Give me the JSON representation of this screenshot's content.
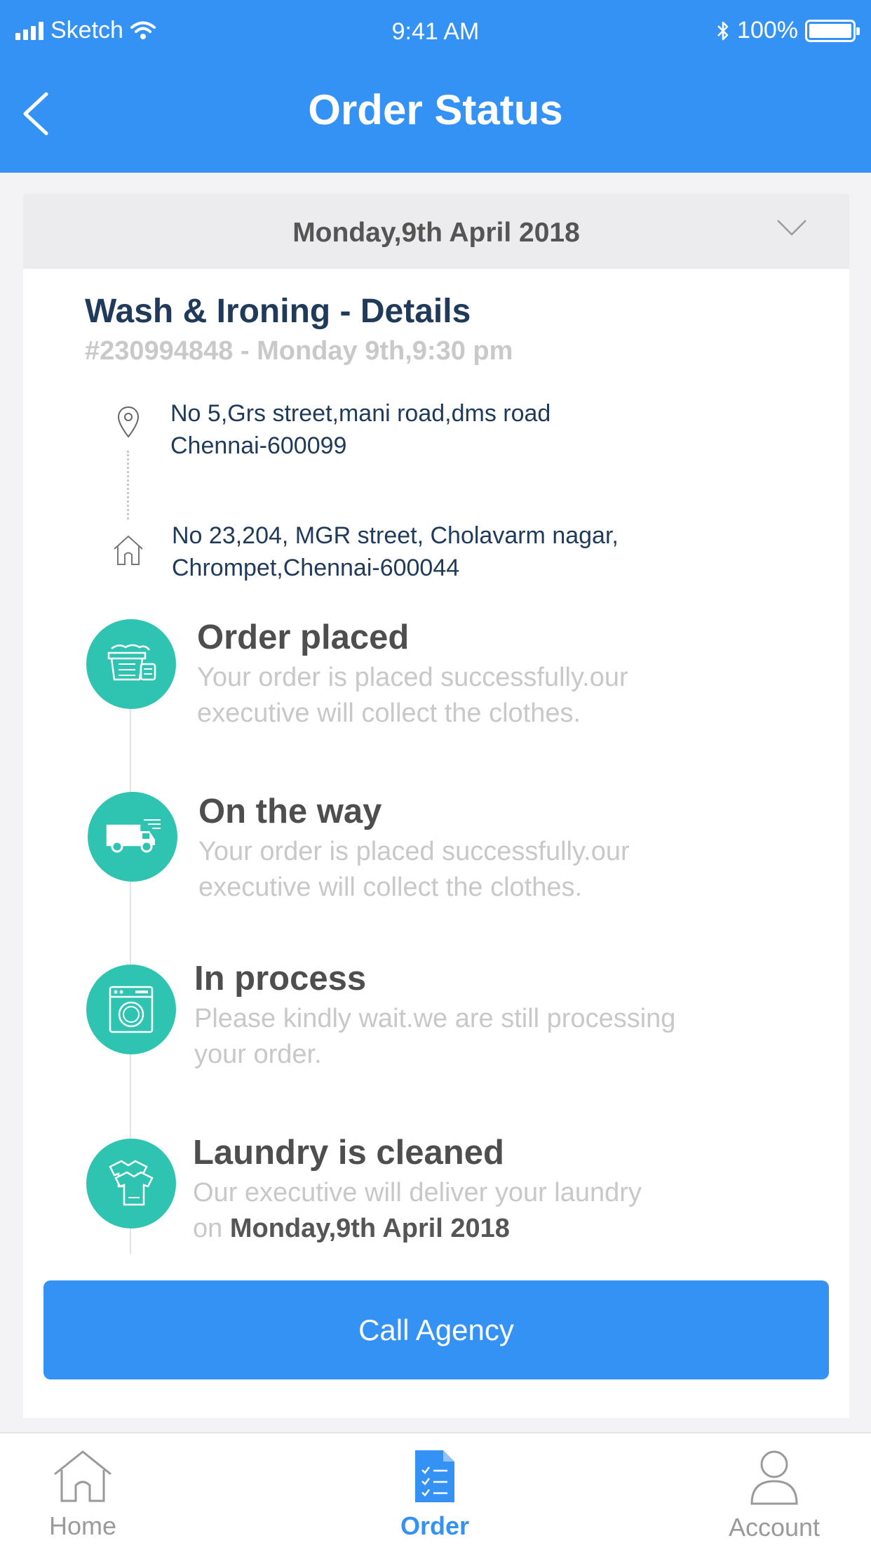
{
  "status_bar": {
    "carrier": "Sketch",
    "time": "9:41 AM",
    "battery": "100%"
  },
  "header": {
    "title": "Order Status"
  },
  "date_selector": {
    "label": "Monday,9th April 2018"
  },
  "order": {
    "title": "Wash & Ironing - Details",
    "subtitle": "#230994848 - Monday 9th,9:30 pm",
    "pickup_address": {
      "line1": "No 5,Grs street,mani road,dms road",
      "line2": "Chennai-600099"
    },
    "delivery_address": {
      "line1": "No 23,204, MGR street, Cholavarm nagar,",
      "line2": "Chrompet,Chennai-600044"
    }
  },
  "steps": [
    {
      "title": "Order placed",
      "desc_line1": "Your order is placed successfully.our",
      "desc_line2": "executive will collect the clothes."
    },
    {
      "title": "On the way",
      "desc_line1": "Your order is placed successfully.our",
      "desc_line2": "executive will collect the clothes."
    },
    {
      "title": "In process",
      "desc_line1": "Please kindly wait.we are still processing",
      "desc_line2": "your order."
    },
    {
      "title": "Laundry is cleaned",
      "desc_line1": "Our executive will deliver your laundry",
      "desc_line2_prefix": "on",
      "desc_line2_bold": "Monday,9th April 2018"
    }
  ],
  "call_button": {
    "label": "Call Agency"
  },
  "tabbar": {
    "items": [
      {
        "label": "Home",
        "icon": "home-icon"
      },
      {
        "label": "Order",
        "icon": "order-document-icon"
      },
      {
        "label": "Account",
        "icon": "account-icon"
      }
    ],
    "active": "Order"
  },
  "colors": {
    "primary": "#3592f5",
    "step_teal": "#2fc4b2",
    "heading_navy": "#1f3a5a"
  }
}
